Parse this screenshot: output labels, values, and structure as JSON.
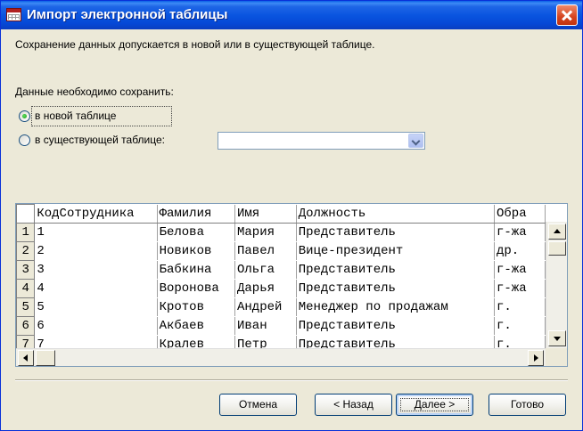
{
  "window": {
    "title": "Импорт электронной таблицы",
    "accent_color": "#0a55e0",
    "close_icon": "close-icon"
  },
  "intro_text": "Сохранение данных допускается в новой или в существующей таблице.",
  "save_group": {
    "label": "Данные необходимо сохранить:",
    "options": [
      {
        "label": "в новой таблице",
        "checked": true
      },
      {
        "label": "в существующей таблице:",
        "checked": false
      }
    ],
    "table_select_value": ""
  },
  "grid": {
    "columns": [
      "КодСотрудника",
      "Фамилия",
      "Имя",
      "Должность",
      "Обра"
    ],
    "rows": [
      {
        "num": "1",
        "cells": [
          "1",
          "Белова",
          "Мария",
          "Представитель",
          "г-жа"
        ]
      },
      {
        "num": "2",
        "cells": [
          "2",
          "Новиков",
          "Павел",
          "Вице-президент",
          "др."
        ]
      },
      {
        "num": "3",
        "cells": [
          "3",
          "Бабкина",
          "Ольга",
          "Представитель",
          "г-жа"
        ]
      },
      {
        "num": "4",
        "cells": [
          "4",
          "Воронова",
          "Дарья",
          "Представитель",
          "г-жа"
        ]
      },
      {
        "num": "5",
        "cells": [
          "5",
          "Кротов",
          "Андрей",
          "Менеджер по продажам",
          "г."
        ]
      },
      {
        "num": "6",
        "cells": [
          "6",
          "Акбаев",
          "Иван",
          "Представитель",
          "г."
        ]
      },
      {
        "num": "7",
        "cells": [
          "7",
          "Кралев",
          "Петр",
          "Представитель",
          "г."
        ]
      }
    ]
  },
  "buttons": {
    "cancel": "Отмена",
    "back": "< Назад",
    "next": "Далее >",
    "finish": "Готово"
  }
}
